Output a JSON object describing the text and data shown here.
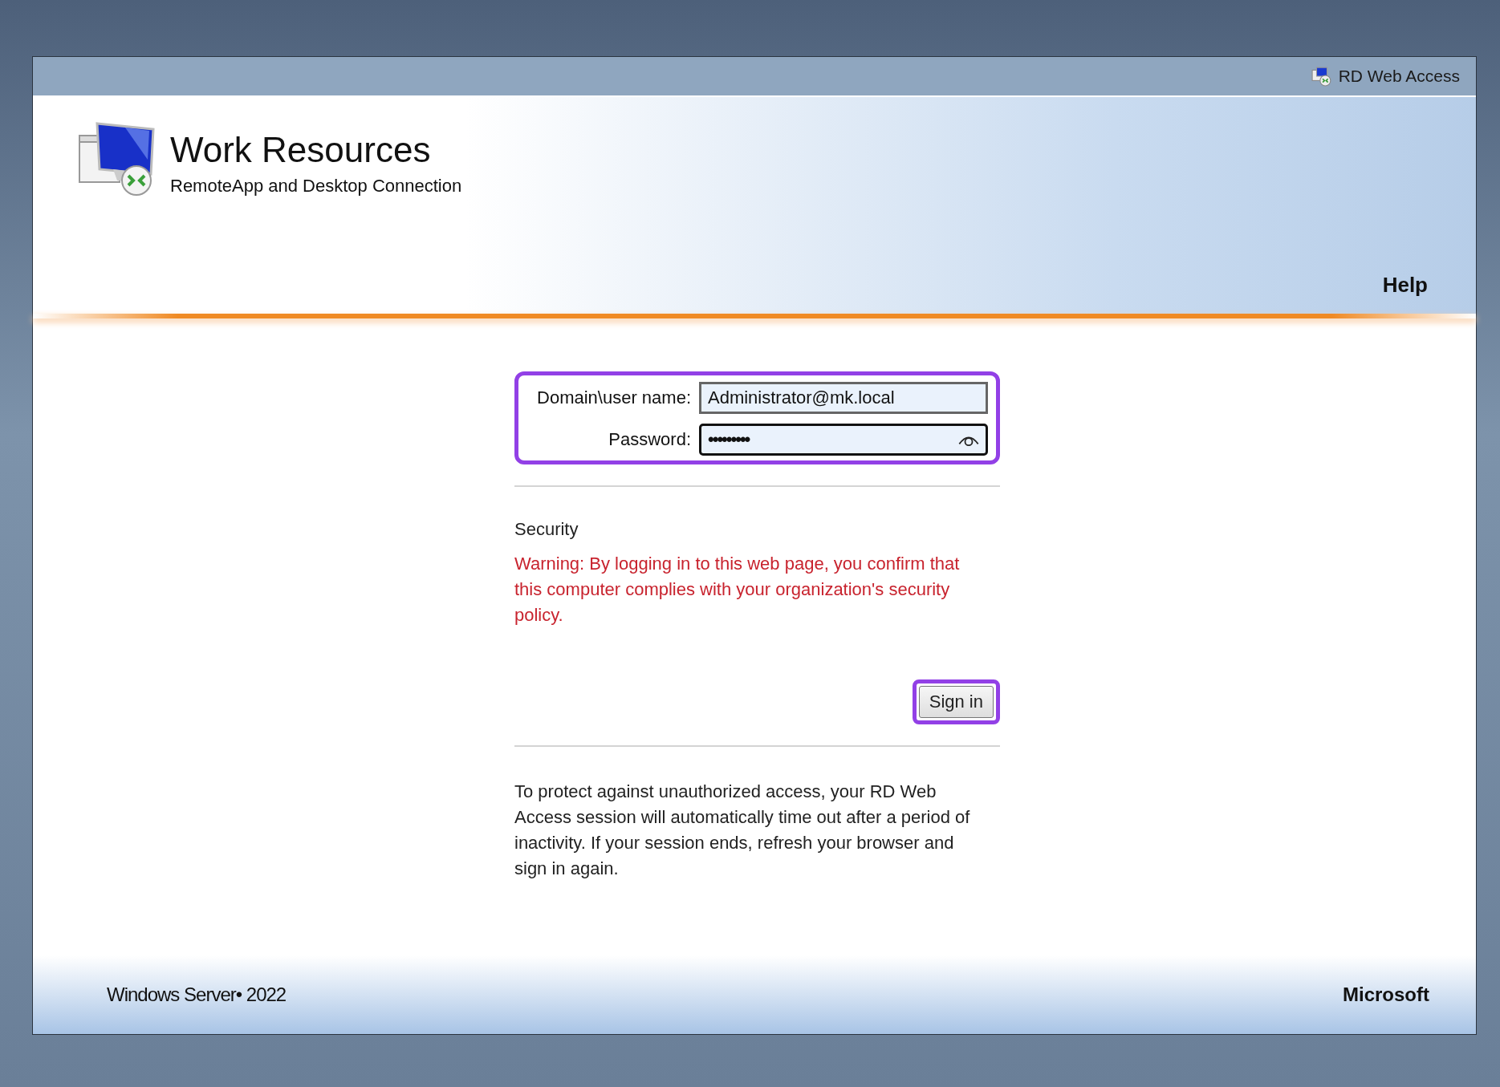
{
  "top_bar": {
    "title": "RD Web Access"
  },
  "header": {
    "title": "Work Resources",
    "subtitle": "RemoteApp and Desktop Connection",
    "help_link": "Help"
  },
  "login_form": {
    "highlighted": true,
    "fields": [
      {
        "label": "Domain\\user name:",
        "value": "Administrator@mk.local",
        "focused": false,
        "kind": "text"
      },
      {
        "label": "Password:",
        "value": "•••••••••",
        "focused": true,
        "kind": "password"
      }
    ]
  },
  "security": {
    "heading": "Security",
    "warning": "Warning: By logging in to this web page, you confirm that this computer complies with your organization's security policy."
  },
  "sign_in": {
    "label": "Sign in",
    "highlighted": true
  },
  "notice": "To protect against unauthorized access, your RD Web Access session will automatically time out after a period of inactivity. If your session ends, refresh your browser and sign in again.",
  "footer": {
    "product": "Windows Server• 2022",
    "vendor": "Microsoft"
  }
}
